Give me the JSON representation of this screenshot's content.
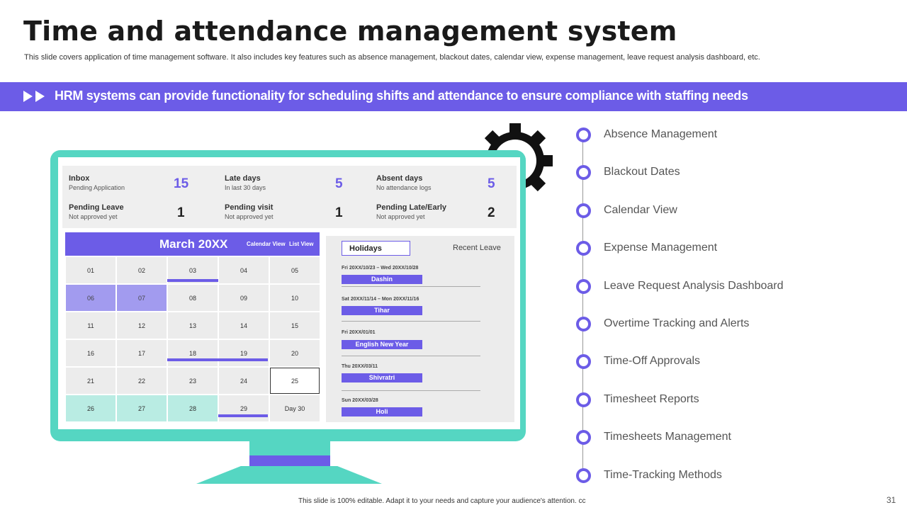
{
  "slide": {
    "title": "Time and attendance management system",
    "subtitle": "This slide covers application of time management software. It also includes key features such as absence management, blackout dates, calendar view, expense management, leave request analysis dashboard, etc.",
    "banner": "HRM systems can provide functionality for scheduling shifts and attendance to ensure compliance with staffing needs",
    "footer": "This slide is 100% editable. Adapt it to your needs and capture your audience's attention. cc",
    "page_number": "31"
  },
  "colors": {
    "accent": "#6c5ce7",
    "teal": "#55d6c2",
    "light_teal": "#b9ece3",
    "lavender": "#a29bef"
  },
  "stats": [
    {
      "label": "Inbox",
      "sub": "Pending Application",
      "value": "15"
    },
    {
      "label": "Late days",
      "sub": "In last 30 days",
      "value": "5"
    },
    {
      "label": "Absent days",
      "sub": "No attendance logs",
      "value": "5"
    },
    {
      "label": "Pending Leave",
      "sub": "Not approved yet",
      "value": "1"
    },
    {
      "label": "Pending visit",
      "sub": "Not approved yet",
      "value": "1"
    },
    {
      "label": "Pending Late/Early",
      "sub": "Not approved yet",
      "value": "2"
    }
  ],
  "calendar": {
    "title": "March 20XX",
    "views": [
      "Calendar View",
      "List View"
    ],
    "days": [
      "01",
      "02",
      "03",
      "04",
      "05",
      "06",
      "07",
      "08",
      "09",
      "10",
      "11",
      "12",
      "13",
      "14",
      "15",
      "16",
      "17",
      "18",
      "19",
      "20",
      "21",
      "22",
      "23",
      "24",
      "25",
      "26",
      "27",
      "28",
      "29",
      "Day 30"
    ]
  },
  "holidays": {
    "tab": "Holidays",
    "recent": "Recent Leave",
    "items": [
      {
        "date": "Fri 20XX/10/23  – Wed 20XX/10/28",
        "name": "Dashin"
      },
      {
        "date": "Sat 20XX/11/14  – Mon 20XX/11/16",
        "name": "Tihar"
      },
      {
        "date": "Fri 20XX/01/01",
        "name": "English New Year"
      },
      {
        "date": "Thu 20XX/03/11",
        "name": "Shivratri"
      },
      {
        "date": "Sun 20XX/03/28",
        "name": "Holi"
      }
    ]
  },
  "features": [
    "Absence Management",
    "Blackout Dates",
    "Calendar View",
    "Expense Management",
    "Leave Request Analysis Dashboard",
    "Overtime Tracking and Alerts",
    "Time-Off Approvals",
    "Timesheet Reports",
    "Timesheets Management",
    "Time-Tracking Methods"
  ]
}
